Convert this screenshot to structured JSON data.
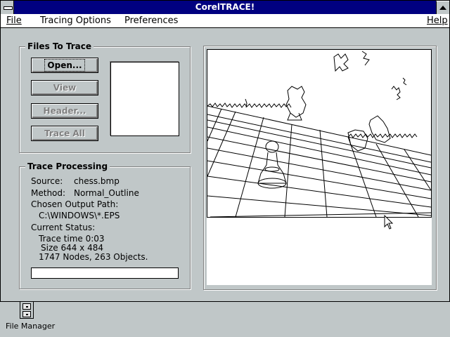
{
  "window": {
    "title": "CorelTRACE!"
  },
  "menu": {
    "file": "File",
    "tracing_options": "Tracing Options",
    "preferences": "Preferences",
    "help": "Help"
  },
  "files_group": {
    "title": "Files To Trace",
    "open_label": "Open...",
    "view_label": "View",
    "header_label": "Header...",
    "trace_all_label": "Trace All"
  },
  "trace_group": {
    "title": "Trace Processing",
    "source_label": "Source:",
    "source_value": "chess.bmp",
    "method_label": "Method:",
    "method_value": "Normal_Outline",
    "output_label": "Chosen Output Path:",
    "output_value": "C:\\WINDOWS\\*.EPS",
    "status_label": "Current Status:",
    "status_line1": "Trace time 0:03",
    "status_line2": "Size 644 x 484",
    "status_line3": "1747 Nodes, 263 Objects."
  },
  "desktop": {
    "file_manager_label": "File Manager"
  },
  "colors": {
    "title_bar": "#000080",
    "face": "#c0c7c8",
    "shadow": "#808080"
  }
}
